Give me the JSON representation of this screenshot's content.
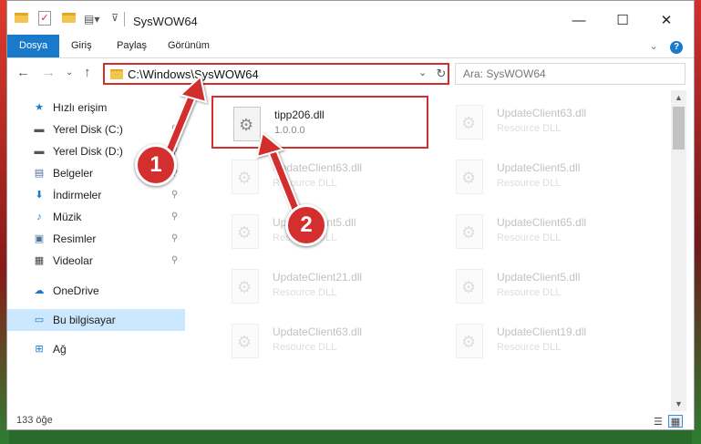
{
  "window": {
    "title": "SysWOW64",
    "minimize": "—",
    "maximize": "☐",
    "close": "✕"
  },
  "ribbon": {
    "tabs": [
      "Dosya",
      "Giriş",
      "Paylaş",
      "Görünüm"
    ],
    "expand": "⌄",
    "help": "?"
  },
  "nav": {
    "back": "←",
    "forward": "→",
    "dropdown": "⌄",
    "up": "↑",
    "address": "C:\\Windows\\SysWOW64",
    "address_dropdown": "⌄",
    "refresh": "↻",
    "search_placeholder": "Ara: SysWOW64"
  },
  "sidebar": {
    "items": [
      {
        "label": "Hızlı erişim",
        "icon": "star-icon",
        "glyph": "★",
        "color": "#1979ca",
        "pinned": false
      },
      {
        "label": "Yerel Disk (C:)",
        "icon": "drive-icon",
        "glyph": "▬",
        "color": "#555555",
        "pinned": true
      },
      {
        "label": "Yerel Disk (D:)",
        "icon": "drive-icon",
        "glyph": "▬",
        "color": "#555555",
        "pinned": true
      },
      {
        "label": "Belgeler",
        "icon": "documents-icon",
        "glyph": "▤",
        "color": "#4a6f9a",
        "pinned": true
      },
      {
        "label": "İndirmeler",
        "icon": "download-icon",
        "glyph": "⬇",
        "color": "#1979ca",
        "pinned": true
      },
      {
        "label": "Müzik",
        "icon": "music-icon",
        "glyph": "♪",
        "color": "#1979ca",
        "pinned": true
      },
      {
        "label": "Resimler",
        "icon": "pictures-icon",
        "glyph": "▣",
        "color": "#4a6f9a",
        "pinned": true
      },
      {
        "label": "Videolar",
        "icon": "video-icon",
        "glyph": "▦",
        "color": "#444444",
        "pinned": true
      },
      {
        "label": "OneDrive",
        "icon": "cloud-icon",
        "glyph": "☁",
        "color": "#1979ca",
        "pinned": false
      },
      {
        "label": "Bu bilgisayar",
        "icon": "computer-icon",
        "glyph": "▭",
        "color": "#1979ca",
        "pinned": false,
        "selected": true
      },
      {
        "label": "Ağ",
        "icon": "network-icon",
        "glyph": "⊞",
        "color": "#1979ca",
        "pinned": false
      }
    ],
    "pin_glyph": "📌"
  },
  "files": [
    {
      "name": "tipp206.dll",
      "desc": "1.0.0.0",
      "highlight": true
    },
    {
      "name": "UpdateClient63.dll",
      "desc": "Resource DLL"
    },
    {
      "name": "UpdateClient63.dll",
      "desc": "Resource DLL"
    },
    {
      "name": "UpdateClient5.dll",
      "desc": "Resource DLL"
    },
    {
      "name": "UpdateClient5.dll",
      "desc": "Resource DLL"
    },
    {
      "name": "UpdateClient65.dll",
      "desc": "Resource DLL"
    },
    {
      "name": "UpdateClient21.dll",
      "desc": "Resource DLL"
    },
    {
      "name": "UpdateClient5.dll",
      "desc": "Resource DLL"
    },
    {
      "name": "UpdateClient63.dll",
      "desc": "Resource DLL"
    },
    {
      "name": "UpdateClient19.dll",
      "desc": "Resource DLL"
    }
  ],
  "status": {
    "count": "133 öğe"
  },
  "annotations": {
    "step1": "1",
    "step2": "2",
    "color": "#d32f2f"
  }
}
